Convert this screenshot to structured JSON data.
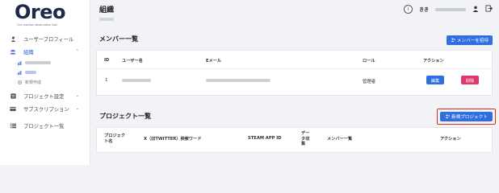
{
  "app": {
    "logo_text": "Oreo",
    "logo_tagline": "Our reaction observation tool"
  },
  "sidebar": {
    "items": [
      {
        "label": "ユーザープロフィール",
        "icon": "person-icon"
      },
      {
        "label": "組織",
        "icon": "group-icon"
      },
      {
        "label": "プロジェクト設定",
        "icon": "settings-box-icon"
      },
      {
        "label": "サブスクリプション",
        "icon": "subscription-icon"
      },
      {
        "label": "プロジェクト一覧",
        "icon": "list-icon"
      }
    ],
    "sub_items": [
      {
        "label": "新規作成"
      }
    ]
  },
  "header": {
    "title": "組織",
    "user_initials": "きき"
  },
  "members": {
    "title": "メンバー一覧",
    "invite_button": "メンバーを招待",
    "columns": [
      "ID",
      "ユーザー名",
      "Eメール",
      "ロール",
      "アクション"
    ],
    "rows": [
      {
        "id": "1",
        "role": "管理者",
        "edit": "編集",
        "delete": "削除"
      }
    ]
  },
  "projects": {
    "title": "プロジェクト一覧",
    "new_button": "新規プロジェクト",
    "columns": [
      "プロジェクト名",
      "X（旧TWITTER）検索ワード",
      "STEAM APP ID",
      "データ収集",
      "メンバー一覧",
      "アクション"
    ]
  },
  "colors": {
    "primary": "#2f6fe0",
    "danger": "#e0386a",
    "highlight": "#e02a2a",
    "active_nav": "#2c5fd9"
  }
}
